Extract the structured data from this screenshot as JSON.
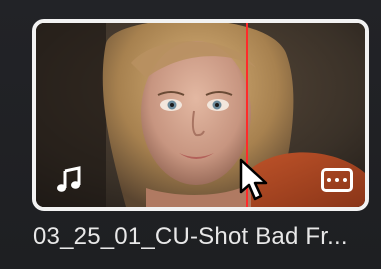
{
  "clip": {
    "name": "03_25_01_CU-Shot Bad Fr...",
    "badges": {
      "audio_icon": "music-note-icon",
      "options_icon": "more-options-icon"
    },
    "colors": {
      "selection_border": "#f2f2f2",
      "playhead": "#ff2a2a",
      "background": "#1f2024"
    }
  }
}
